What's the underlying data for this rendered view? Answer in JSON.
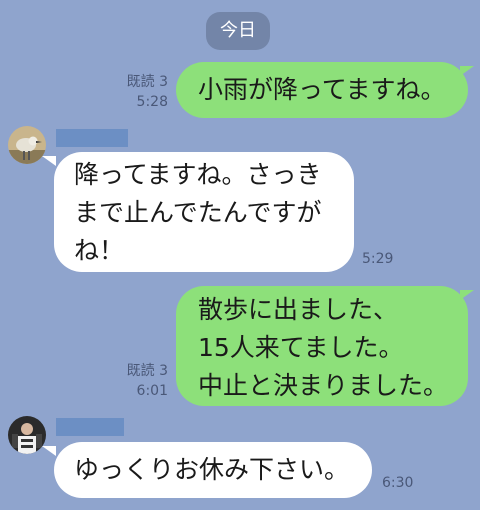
{
  "chat": {
    "date_divider": "今日",
    "messages": [
      {
        "side": "out",
        "lines": [
          "小雨が降ってますね。"
        ],
        "read": "既読 3",
        "time": "5:28"
      },
      {
        "side": "in",
        "lines": [
          "降ってますね。さっき",
          "まで止んでたんですが",
          "ね！"
        ],
        "time": "5:29"
      },
      {
        "side": "out",
        "lines": [
          "散歩に出ました、",
          "15人来てました。",
          "中止と決まりました。"
        ],
        "read": "既読 3",
        "time": "6:01"
      },
      {
        "side": "in",
        "lines": [
          "ゆっくりお休み下さい。"
        ],
        "time": "6:30"
      }
    ]
  },
  "colors": {
    "background": "#8fa4cd",
    "outgoing_bubble": "#8de07a",
    "incoming_bubble": "#ffffff",
    "date_chip": "#7385a8",
    "meta_text": "#4a5878"
  },
  "icons": {
    "avatar_1": "bird-avatar-icon",
    "avatar_2": "person-avatar-icon"
  }
}
